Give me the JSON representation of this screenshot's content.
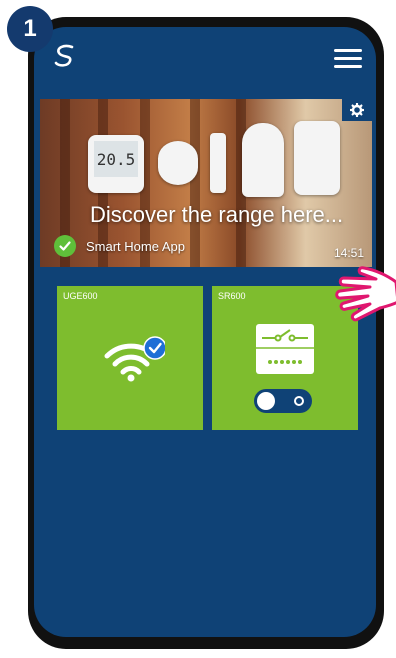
{
  "step": {
    "number": "1"
  },
  "app": {
    "logo_icon": "salus-logo-icon",
    "menu_icon": "hamburger-menu-icon"
  },
  "banner": {
    "headline": "Discover the range here...",
    "subtitle": "Smart Home App",
    "duration": "14:51",
    "thermostat_reading": "20.5"
  },
  "tiles": [
    {
      "label": "UGE600",
      "icon": "wifi-connected-icon"
    },
    {
      "label": "SR600",
      "icon": "relay-switch-icon",
      "toggle_state": "off"
    }
  ],
  "colors": {
    "background": "#0f4276",
    "tile": "#7ebd2e",
    "badge": "#143a6e",
    "hand": "#e0176f",
    "check": "#5fbf3a"
  }
}
